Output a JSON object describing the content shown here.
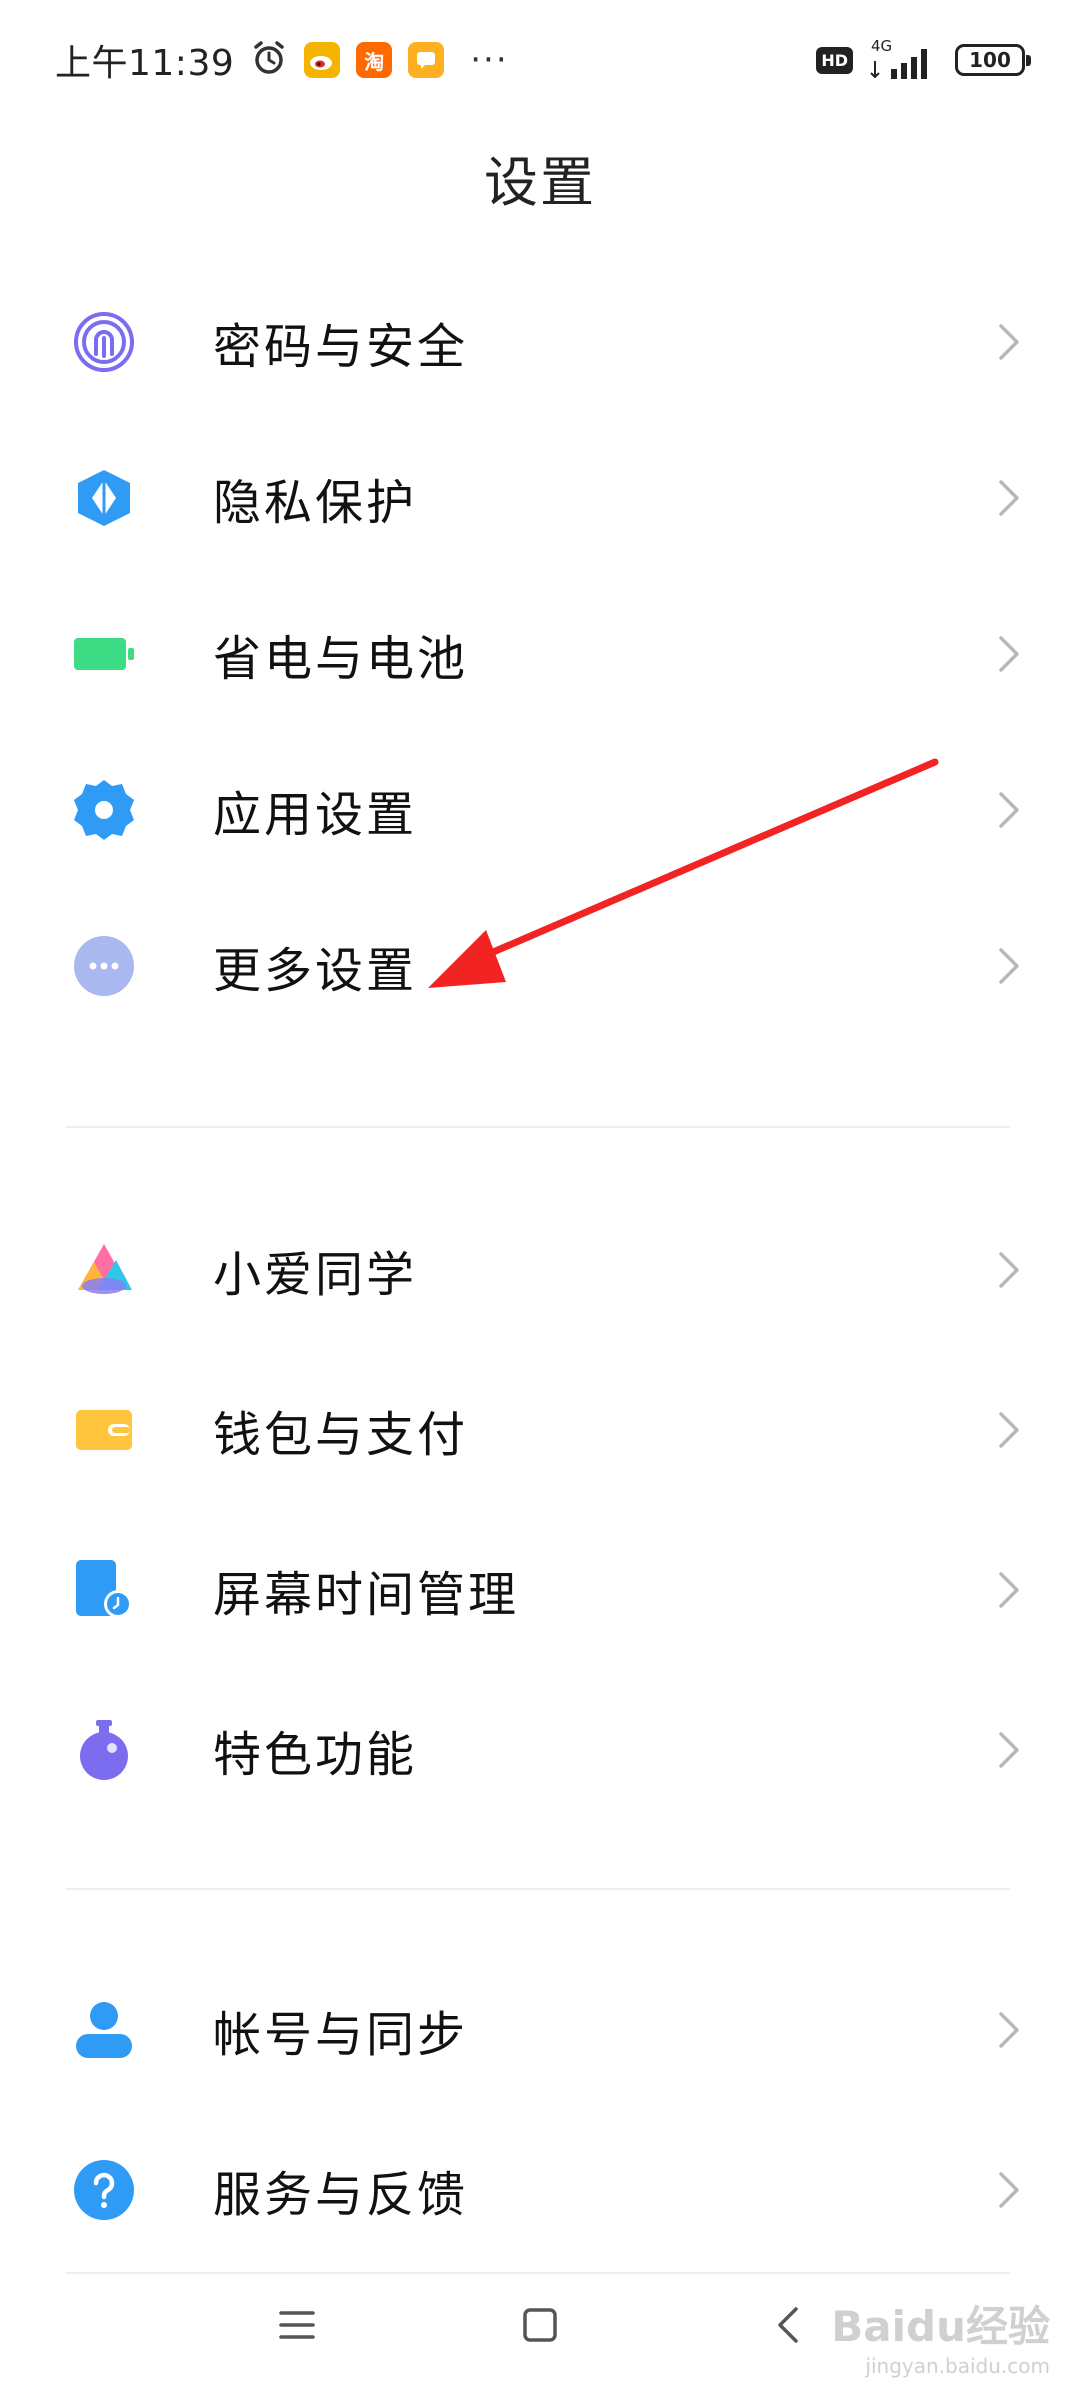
{
  "status_bar": {
    "time": "上午11:39",
    "alarm_icon": "alarm-clock-icon",
    "apps": [
      {
        "name": "weibo-app-icon",
        "glyph": "◉",
        "color": "#f5b400"
      },
      {
        "name": "taobao-app-icon",
        "glyph": "淘",
        "color": "#ff6a00"
      },
      {
        "name": "message-app-icon",
        "glyph": "▢",
        "color": "#ffb020"
      }
    ],
    "more": "···",
    "hd_badge": "HD",
    "network": "4G",
    "battery": "100"
  },
  "title": "设置",
  "groups": [
    {
      "items": [
        {
          "label": "密码与安全",
          "icon": "fingerprint-icon",
          "color": "#7b6cf0"
        },
        {
          "label": "隐私保护",
          "icon": "privacy-shield-icon",
          "color": "#2f9bf5"
        },
        {
          "label": "省电与电池",
          "icon": "battery-icon",
          "color": "#3ddc84"
        },
        {
          "label": "应用设置",
          "icon": "gear-icon",
          "color": "#2f9bf5"
        },
        {
          "label": "更多设置",
          "icon": "more-dots-icon",
          "color": "#a9b8ef"
        }
      ]
    },
    {
      "items": [
        {
          "label": "小爱同学",
          "icon": "xiaoai-icon",
          "color": "#ff6fa4"
        },
        {
          "label": "钱包与支付",
          "icon": "wallet-icon",
          "color": "#ffc53d"
        },
        {
          "label": "屏幕时间管理",
          "icon": "screen-time-icon",
          "color": "#2f9bf5"
        },
        {
          "label": "特色功能",
          "icon": "flask-icon",
          "color": "#7b6cf0"
        }
      ]
    },
    {
      "items": [
        {
          "label": "帐号与同步",
          "icon": "account-icon",
          "color": "#2f9bf5"
        },
        {
          "label": "服务与反馈",
          "icon": "help-icon",
          "color": "#2f9bf5"
        }
      ]
    }
  ],
  "navbar": {
    "menu_icon": "menu-icon",
    "home_icon": "home-icon",
    "back_icon": "back-icon"
  },
  "annotation": {
    "color": "#f22323",
    "target": "更多设置"
  },
  "watermark": {
    "main": "Baidu经验",
    "sub": "jingyan.baidu.com"
  }
}
